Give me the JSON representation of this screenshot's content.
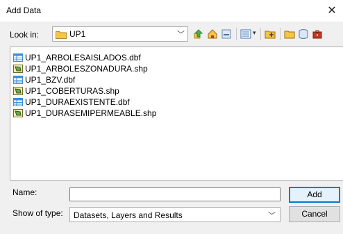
{
  "window": {
    "title": "Add Data",
    "close_glyph": "✕"
  },
  "look_in": {
    "label": "Look in:",
    "value": "UP1"
  },
  "toolbar": {
    "icons": [
      "up-one-level-icon",
      "home-icon",
      "connect-folder-icon",
      "view-menu-icon",
      "new-geodatabase-icon",
      "folder-icon",
      "new-table-icon",
      "toolbox-icon"
    ]
  },
  "files": [
    {
      "name": "UP1_ARBOLESAISLADOS.dbf",
      "icon": "table-icon"
    },
    {
      "name": "UP1_ARBOLESZONADURA.shp",
      "icon": "polygon-shapefile-icon"
    },
    {
      "name": "UP1_BZV.dbf",
      "icon": "table-icon"
    },
    {
      "name": "UP1_COBERTURAS.shp",
      "icon": "polygon-shapefile-icon"
    },
    {
      "name": "UP1_DURAEXISTENTE.dbf",
      "icon": "table-icon"
    },
    {
      "name": "UP1_DURASEMIPERMEABLE.shp",
      "icon": "polygon-shapefile-icon"
    }
  ],
  "name_field": {
    "label": "Name:",
    "value": ""
  },
  "type_field": {
    "label": "Show of type:",
    "value": "Datasets, Layers and Results"
  },
  "buttons": {
    "add": "Add",
    "cancel": "Cancel"
  },
  "colors": {
    "accent": "#0078d7",
    "folder": "#f5c54a",
    "table": "#3b8ed8",
    "shapefile": "#5a8a2e"
  }
}
